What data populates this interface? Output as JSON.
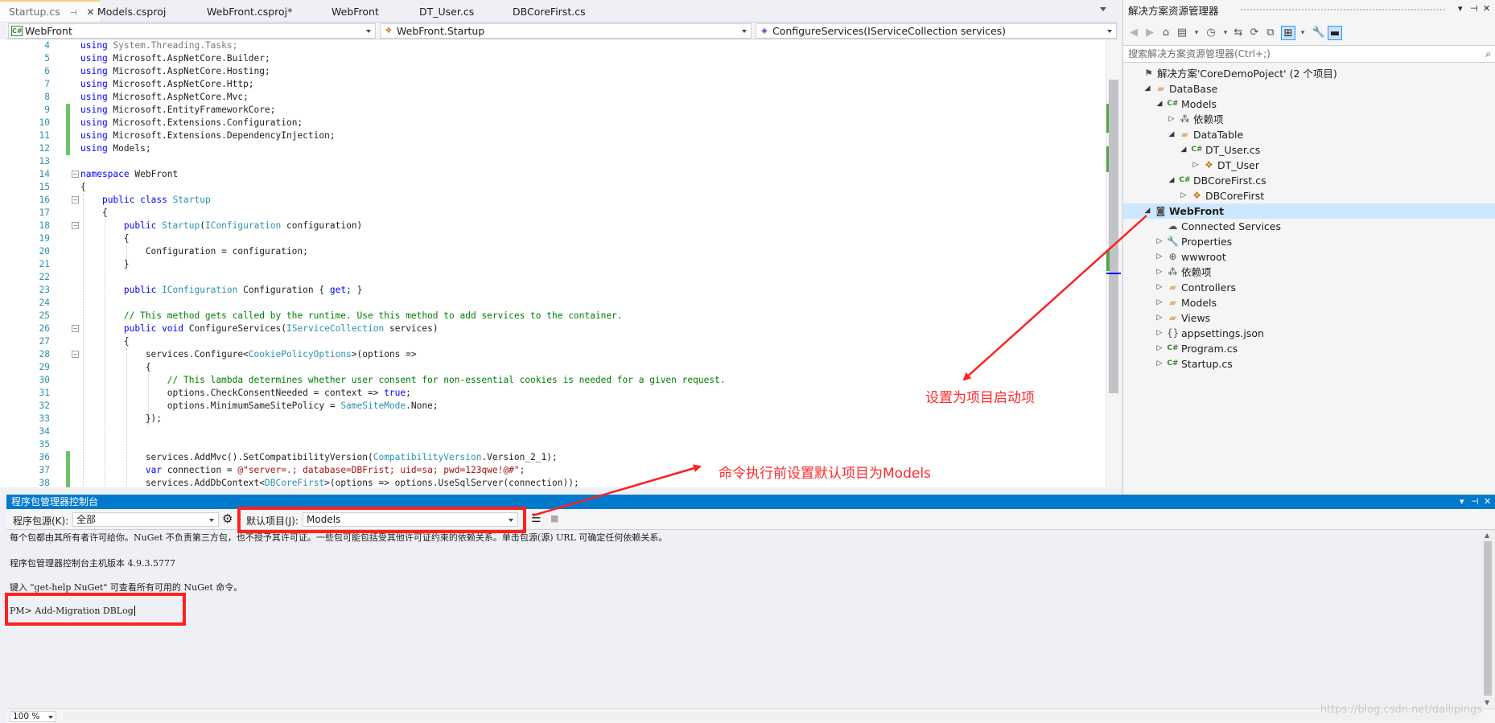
{
  "editor": {
    "tabs": [
      {
        "label": "Startup.cs",
        "active": true
      },
      {
        "label": "Models.csproj"
      },
      {
        "label": "WebFront.csproj*"
      },
      {
        "label": "WebFront"
      },
      {
        "label": "DT_User.cs"
      },
      {
        "label": "DBCoreFirst.cs"
      }
    ],
    "nav": {
      "project": "WebFront",
      "type": "WebFront.Startup",
      "member": "ConfigureServices(IServiceCollection services)"
    },
    "lines": [
      {
        "n": "4",
        "text": "using System.Threading.Tasks;"
      },
      {
        "n": "5",
        "text": "using Microsoft.AspNetCore.Builder;"
      },
      {
        "n": "6",
        "text": "using Microsoft.AspNetCore.Hosting;"
      },
      {
        "n": "7",
        "text": "using Microsoft.AspNetCore.Http;"
      },
      {
        "n": "8",
        "text": "using Microsoft.AspNetCore.Mvc;"
      },
      {
        "n": "9",
        "text": "using Microsoft.EntityFrameworkCore;"
      },
      {
        "n": "10",
        "text": "using Microsoft.Extensions.Configuration;"
      },
      {
        "n": "11",
        "text": "using Microsoft.Extensions.DependencyInjection;"
      },
      {
        "n": "12",
        "text": "using Models;"
      },
      {
        "n": "13",
        "text": ""
      },
      {
        "n": "14",
        "text": "namespace WebFront"
      },
      {
        "n": "15",
        "text": "{"
      },
      {
        "n": "16",
        "text": "    public class Startup"
      },
      {
        "n": "17",
        "text": "    {"
      },
      {
        "n": "18",
        "text": "        public Startup(IConfiguration configuration)"
      },
      {
        "n": "19",
        "text": "        {"
      },
      {
        "n": "20",
        "text": "            Configuration = configuration;"
      },
      {
        "n": "21",
        "text": "        }"
      },
      {
        "n": "22",
        "text": ""
      },
      {
        "n": "23",
        "text": "        public IConfiguration Configuration { get; }"
      },
      {
        "n": "24",
        "text": ""
      },
      {
        "n": "25",
        "text": "        // This method gets called by the runtime. Use this method to add services to the container."
      },
      {
        "n": "26",
        "text": "        public void ConfigureServices(IServiceCollection services)"
      },
      {
        "n": "27",
        "text": "        {"
      },
      {
        "n": "28",
        "text": "            services.Configure<CookiePolicyOptions>(options =>"
      },
      {
        "n": "29",
        "text": "            {"
      },
      {
        "n": "30",
        "text": "                // This lambda determines whether user consent for non-essential cookies is needed for a given request."
      },
      {
        "n": "31",
        "text": "                options.CheckConsentNeeded = context => true;"
      },
      {
        "n": "32",
        "text": "                options.MinimumSameSitePolicy = SameSiteMode.None;"
      },
      {
        "n": "33",
        "text": "            });"
      },
      {
        "n": "34",
        "text": ""
      },
      {
        "n": "35",
        "text": ""
      },
      {
        "n": "36",
        "text": "            services.AddMvc().SetCompatibilityVersion(CompatibilityVersion.Version_2_1);"
      },
      {
        "n": "37",
        "text": "            var connection = @\"server=.; database=DBFrist; uid=sa; pwd=123qwe!@#\";"
      },
      {
        "n": "38",
        "text": "            services.AddDbContext<DBCoreFirst>(options => options.UseSqlServer(connection));"
      }
    ]
  },
  "solution_explorer": {
    "title": "解决方案资源管理器",
    "search_placeholder": "搜索解决方案资源管理器(Ctrl+;)",
    "tree": [
      {
        "label": "解决方案'CoreDemoPoject' (2 个项目)",
        "icon": "solution-icon"
      },
      {
        "label": "DataBase",
        "icon": "folder-icon"
      },
      {
        "label": "Models",
        "icon": "csharp-project-icon"
      },
      {
        "label": "依赖项",
        "icon": "dependencies-icon"
      },
      {
        "label": "DataTable",
        "icon": "folder-icon"
      },
      {
        "label": "DT_User.cs",
        "icon": "csharp-file-icon"
      },
      {
        "label": "DT_User",
        "icon": "class-icon"
      },
      {
        "label": "DBCoreFirst.cs",
        "icon": "csharp-file-icon"
      },
      {
        "label": "DBCoreFirst",
        "icon": "class-icon"
      },
      {
        "label": "WebFront",
        "icon": "web-project-icon"
      },
      {
        "label": "Connected Services",
        "icon": "connected-services-icon"
      },
      {
        "label": "Properties",
        "icon": "wrench-icon"
      },
      {
        "label": "wwwroot",
        "icon": "globe-icon"
      },
      {
        "label": "依赖项",
        "icon": "dependencies-icon"
      },
      {
        "label": "Controllers",
        "icon": "folder-icon"
      },
      {
        "label": "Models",
        "icon": "folder-icon"
      },
      {
        "label": "Views",
        "icon": "folder-icon"
      },
      {
        "label": "appsettings.json",
        "icon": "json-file-icon"
      },
      {
        "label": "Program.cs",
        "icon": "csharp-file-icon"
      },
      {
        "label": "Startup.cs",
        "icon": "csharp-file-icon"
      }
    ]
  },
  "package_console": {
    "title": "程序包管理器控制台",
    "source_label": "程序包源(K):",
    "source_value": "全部",
    "default_project_label": "默认项目(J):",
    "default_project_value": "Models",
    "output": [
      "每个包都由其所有者许可给你。NuGet 不负责第三方包，也不授予其许可证。一些包可能包括受其他许可证约束的依赖关系。单击包源(源) URL 可确定任何依赖关系。",
      "程序包管理器控制台主机版本 4.9.3.5777",
      "键入 \"get-help NuGet\" 可查看所有可用的 NuGet 命令。",
      "PM> Add-Migration DBLog"
    ],
    "zoom": "100 %",
    "watermark": "https://blog.csdn.net/dailipings"
  },
  "annotations": {
    "startup_note": "设置为项目启动项",
    "default_project_note": "命令执行前设置默认项目为Models",
    "color": "#ff2020"
  }
}
